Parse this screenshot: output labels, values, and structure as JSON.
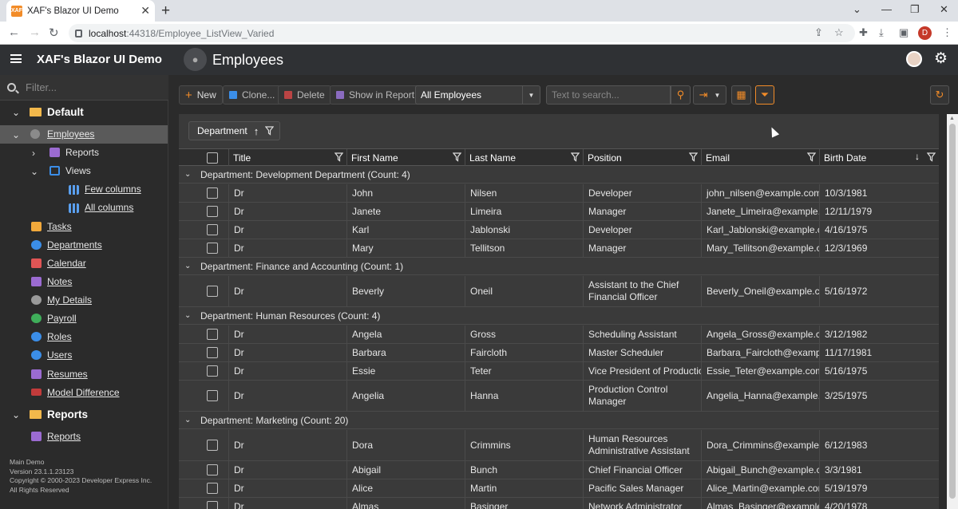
{
  "browser": {
    "tab_title": "XAF's Blazor UI Demo",
    "favicon_text": "XAF",
    "url_host": "localhost",
    "url_rest": ":44318/Employee_ListView_Varied",
    "profile_initial": "D"
  },
  "header": {
    "app_title": "XAF's Blazor UI Demo",
    "page_title": "Employees"
  },
  "sidebar": {
    "filter_placeholder": "Filter...",
    "groups": [
      {
        "label": "Default"
      },
      {
        "label": "Reports"
      }
    ],
    "items": [
      {
        "label": "Employees",
        "icon": "employee-icon"
      },
      {
        "label": "Reports",
        "icon": "report-icon"
      },
      {
        "label": "Views",
        "icon": "views-icon"
      },
      {
        "label": "Few columns",
        "icon": "columns-icon"
      },
      {
        "label": "All columns",
        "icon": "columns-icon"
      },
      {
        "label": "Tasks",
        "icon": "tasks-icon"
      },
      {
        "label": "Departments",
        "icon": "departments-icon"
      },
      {
        "label": "Calendar",
        "icon": "calendar-icon"
      },
      {
        "label": "Notes",
        "icon": "notes-icon"
      },
      {
        "label": "My Details",
        "icon": "user-details-icon"
      },
      {
        "label": "Payroll",
        "icon": "payroll-icon"
      },
      {
        "label": "Roles",
        "icon": "roles-icon"
      },
      {
        "label": "Users",
        "icon": "users-icon"
      },
      {
        "label": "Resumes",
        "icon": "resumes-icon"
      },
      {
        "label": "Model Difference",
        "icon": "model-difference-icon"
      },
      {
        "label": "Reports",
        "icon": "report-icon"
      }
    ],
    "footer": {
      "line1": "Main Demo",
      "line2": "Version 23.1.1.23123",
      "line3": "Copyright © 2000-2023 Developer Express Inc.",
      "line4": "All Rights Reserved"
    }
  },
  "toolbar": {
    "new_label": "New",
    "clone_label": "Clone...",
    "delete_label": "Delete",
    "show_in_report_label": "Show in Report",
    "filter_combo_value": "All Employees",
    "search_placeholder": "Text to search..."
  },
  "grid": {
    "group_chip": "Department",
    "columns": [
      "Title",
      "First Name",
      "Last Name",
      "Position",
      "Email",
      "Birth Date"
    ],
    "groups": [
      {
        "caption": "Department: Development Department (Count: 4)",
        "rows": [
          [
            "Dr",
            "John",
            "Nilsen",
            "Developer",
            "john_nilsen@example.com",
            "10/3/1981"
          ],
          [
            "Dr",
            "Janete",
            "Limeira",
            "Manager",
            "Janete_Limeira@example.c...",
            "12/11/1979"
          ],
          [
            "Dr",
            "Karl",
            "Jablonski",
            "Developer",
            "Karl_Jablonski@example.c...",
            "4/16/1975"
          ],
          [
            "Dr",
            "Mary",
            "Tellitson",
            "Manager",
            "Mary_Tellitson@example.c...",
            "12/3/1969"
          ]
        ]
      },
      {
        "caption": "Department: Finance and Accounting (Count: 1)",
        "rows": [
          [
            "Dr",
            "Beverly",
            "Oneil",
            "Assistant to the Chief Financial Officer",
            "Beverly_Oneil@example.co...",
            "5/16/1972"
          ]
        ]
      },
      {
        "caption": "Department: Human Resources (Count: 4)",
        "rows": [
          [
            "Dr",
            "Angela",
            "Gross",
            "Scheduling Assistant",
            "Angela_Gross@example.co...",
            "3/12/1982"
          ],
          [
            "Dr",
            "Barbara",
            "Faircloth",
            "Master Scheduler",
            "Barbara_Faircloth@exampl...",
            "11/17/1981"
          ],
          [
            "Dr",
            "Essie",
            "Teter",
            "Vice President of Production",
            "Essie_Teter@example.com",
            "5/16/1975"
          ],
          [
            "Dr",
            "Angelia",
            "Hanna",
            "Production Control Manager",
            "Angelia_Hanna@example....",
            "3/25/1975"
          ]
        ]
      },
      {
        "caption": "Department: Marketing (Count: 20)",
        "rows": [
          [
            "Dr",
            "Dora",
            "Crimmins",
            "Human Resources Administrative Assistant",
            "Dora_Crimmins@example....",
            "6/12/1983"
          ],
          [
            "Dr",
            "Abigail",
            "Bunch",
            "Chief Financial Officer",
            "Abigail_Bunch@example.c...",
            "3/3/1981"
          ],
          [
            "Dr",
            "Alice",
            "Martin",
            "Pacific Sales Manager",
            "Alice_Martin@example.com",
            "5/19/1979"
          ],
          [
            "Dr",
            "Almas",
            "Basinger",
            "Network Administrator",
            "Almas_Basinger@example....",
            "4/20/1978"
          ]
        ]
      }
    ]
  },
  "colors": {
    "accent": "#f28c28",
    "header_bg": "#2f3134",
    "grid_bg": "#3a3a3a",
    "selected_nav": "#5a5a5a"
  }
}
